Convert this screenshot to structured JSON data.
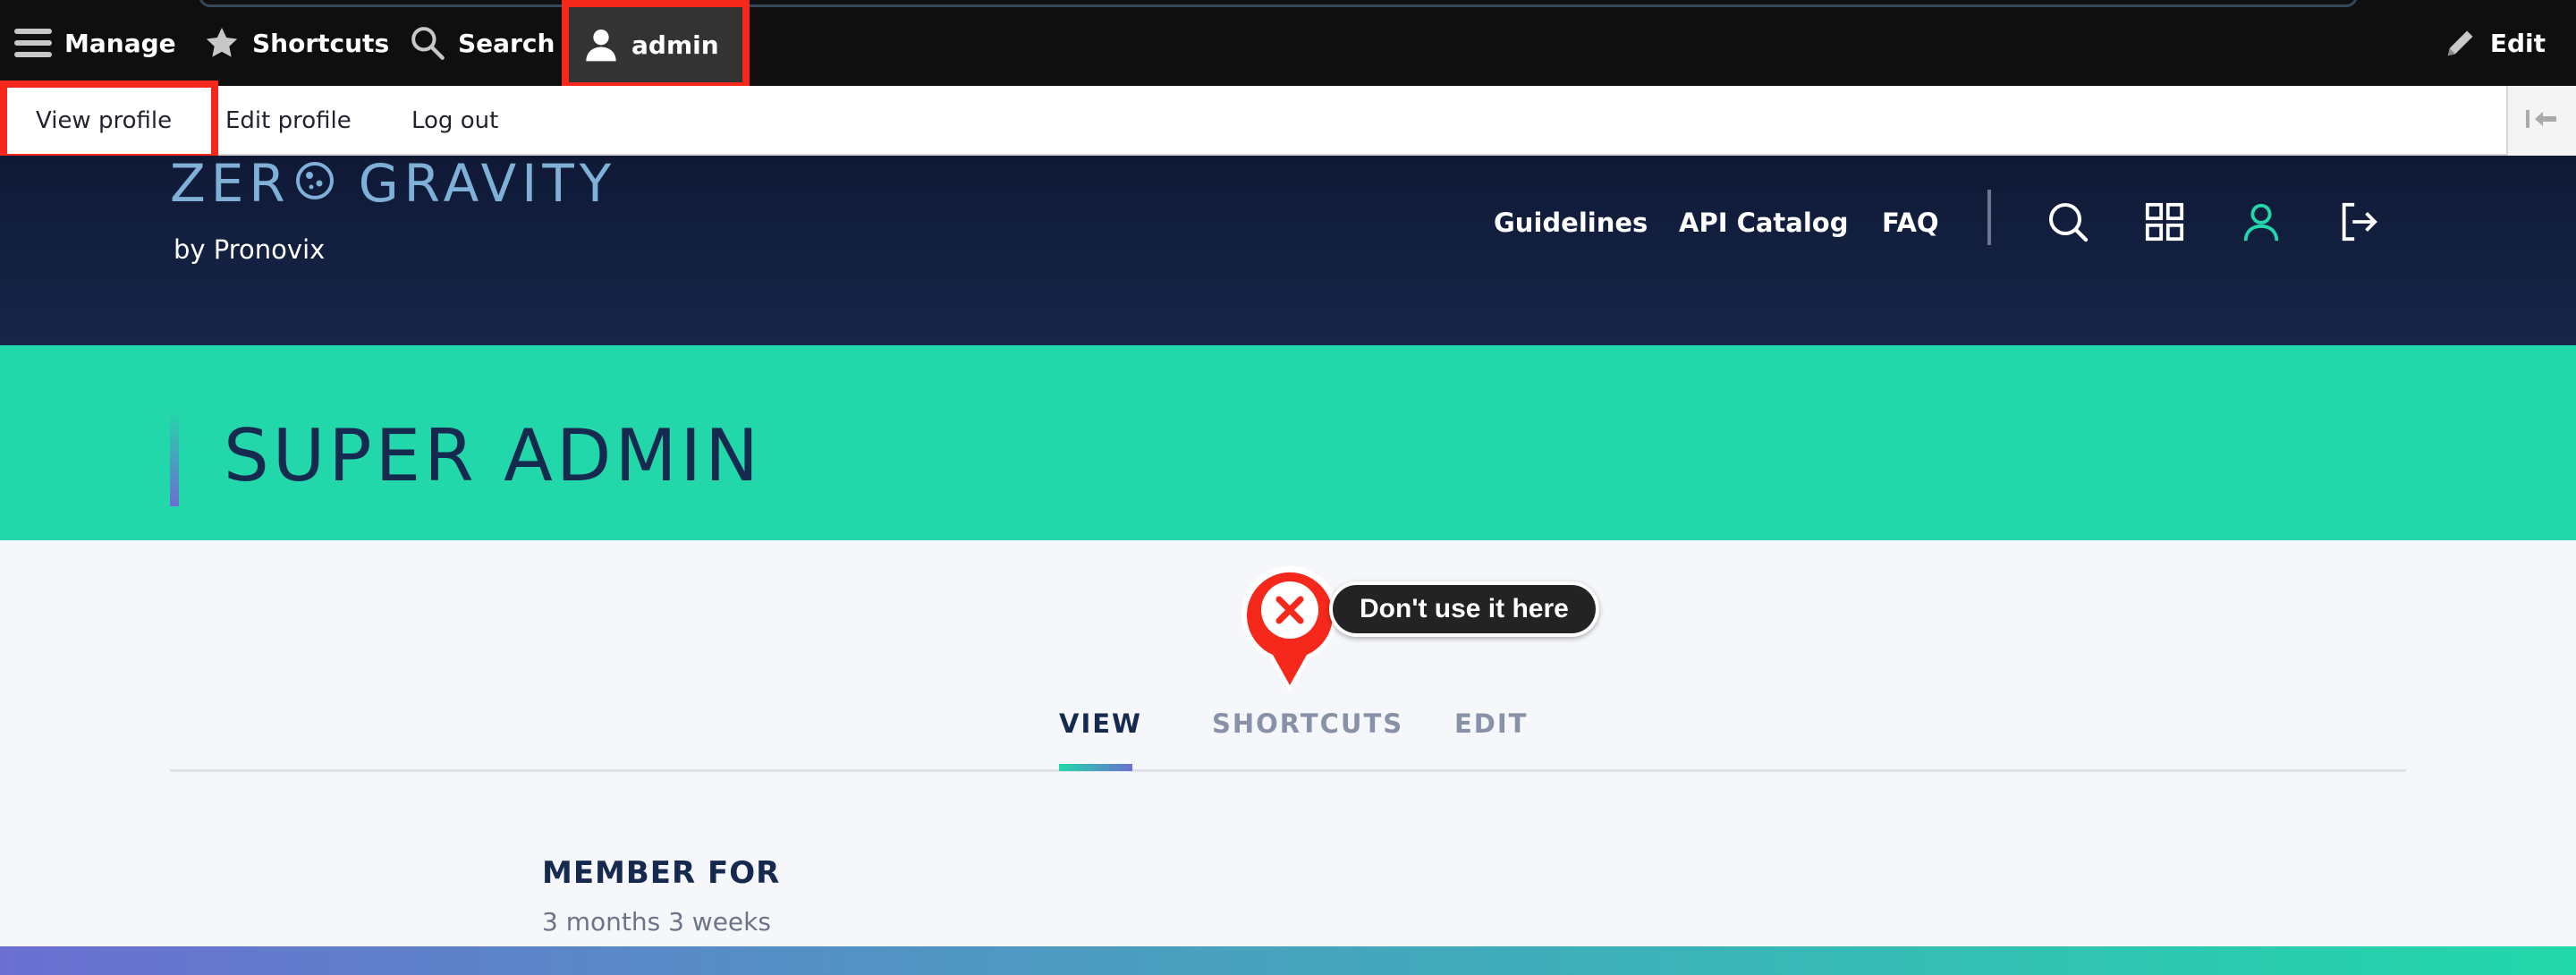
{
  "toolbar": {
    "manage_label": "Manage",
    "shortcuts_label": "Shortcuts",
    "search_label": "Search",
    "user_label": "admin",
    "edit_label": "Edit"
  },
  "tray": {
    "view_profile": "View profile",
    "edit_profile": "Edit profile",
    "log_out": "Log out"
  },
  "site": {
    "logo_text_left": "ZER",
    "logo_text_right": "GRAVITY",
    "logo_sub": "by Pronovix",
    "nav": [
      "Guidelines",
      "API Catalog",
      "FAQ"
    ],
    "icons": [
      "search-icon",
      "grid-icon",
      "user-icon",
      "logout-icon"
    ],
    "accent_color": "#22d8aa",
    "header_color": "#0f1936"
  },
  "page": {
    "title": "SUPER ADMIN",
    "tabs": [
      "VIEW",
      "SHORTCUTS",
      "EDIT"
    ],
    "active_tab": "VIEW",
    "member_label": "MEMBER FOR",
    "member_value": "3 months 3 weeks"
  },
  "annotation": {
    "message": "Don't use it here",
    "highlight_color": "#f5281b"
  }
}
